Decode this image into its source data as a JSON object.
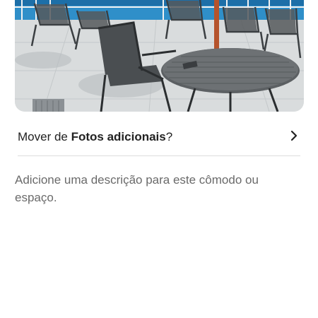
{
  "photo": {
    "icon": "patio-photo",
    "description_alt": "Foto do cômodo"
  },
  "move_row": {
    "prefix": "Mover de ",
    "album_name": "Fotos adicionais",
    "suffix": "?",
    "icon": "chevron-right-icon"
  },
  "description": {
    "text": "Adicione uma descrição para este cômodo ou espaço."
  },
  "colors": {
    "text_primary": "#222222",
    "text_secondary": "#6a6a6a",
    "divider": "#dddddd"
  }
}
